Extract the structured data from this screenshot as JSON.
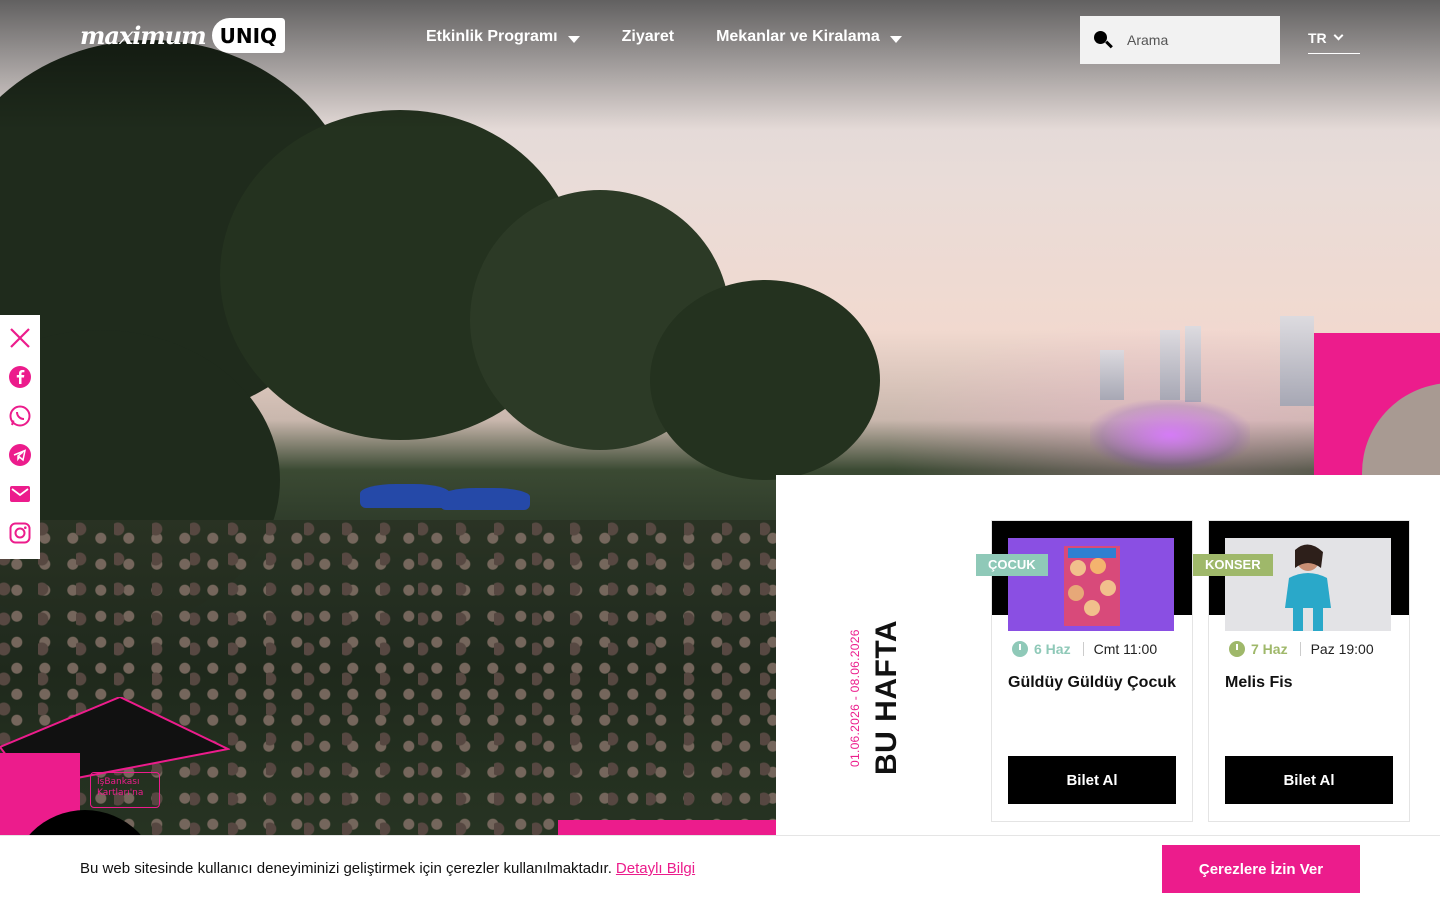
{
  "brand": {
    "logo_maximum": "maximum",
    "logo_uniq": "UNIQ",
    "accent": "#ec1c8c"
  },
  "nav": {
    "items": [
      {
        "label": "Etkinlik Programı",
        "has_dropdown": true
      },
      {
        "label": "Ziyaret",
        "has_dropdown": false
      },
      {
        "label": "Mekanlar ve Kiralama",
        "has_dropdown": true
      }
    ]
  },
  "search": {
    "placeholder": "Arama",
    "icon": "search-icon"
  },
  "language": {
    "selected": "TR"
  },
  "social": {
    "icons": [
      "x-icon",
      "facebook-icon",
      "whatsapp-icon",
      "telegram-icon",
      "mail-icon",
      "instagram-icon"
    ]
  },
  "decor": {
    "card_badge_text": "İşBankası Kartları'na"
  },
  "this_week": {
    "title": "BU HAFTA",
    "date_range": "01.06.2026 - 08.06.2026",
    "events": [
      {
        "category": "ÇOCUK",
        "category_color": "#8fc9b8",
        "day": "6 Haz",
        "day_color": "#8fc9b8",
        "when": "Cmt 11:00",
        "name": "Güldüy Güldüy Çocuk",
        "buy_label": "Bilet Al",
        "image_bg": "#8a4fe3"
      },
      {
        "category": "KONSER",
        "category_color": "#9fb86a",
        "day": "7 Haz",
        "day_color": "#9fb86a",
        "when": "Paz 19:00",
        "name": "Melis Fis",
        "buy_label": "Bilet Al",
        "image_bg": "#e3e3e6"
      }
    ]
  },
  "cookie": {
    "text": "Bu web sitesinde kullanıcı deneyiminizi geliştirmek için çerezler kullanılmaktadır.",
    "link": "Detaylı Bilgi",
    "button": "Çerezlere İzin Ver"
  }
}
